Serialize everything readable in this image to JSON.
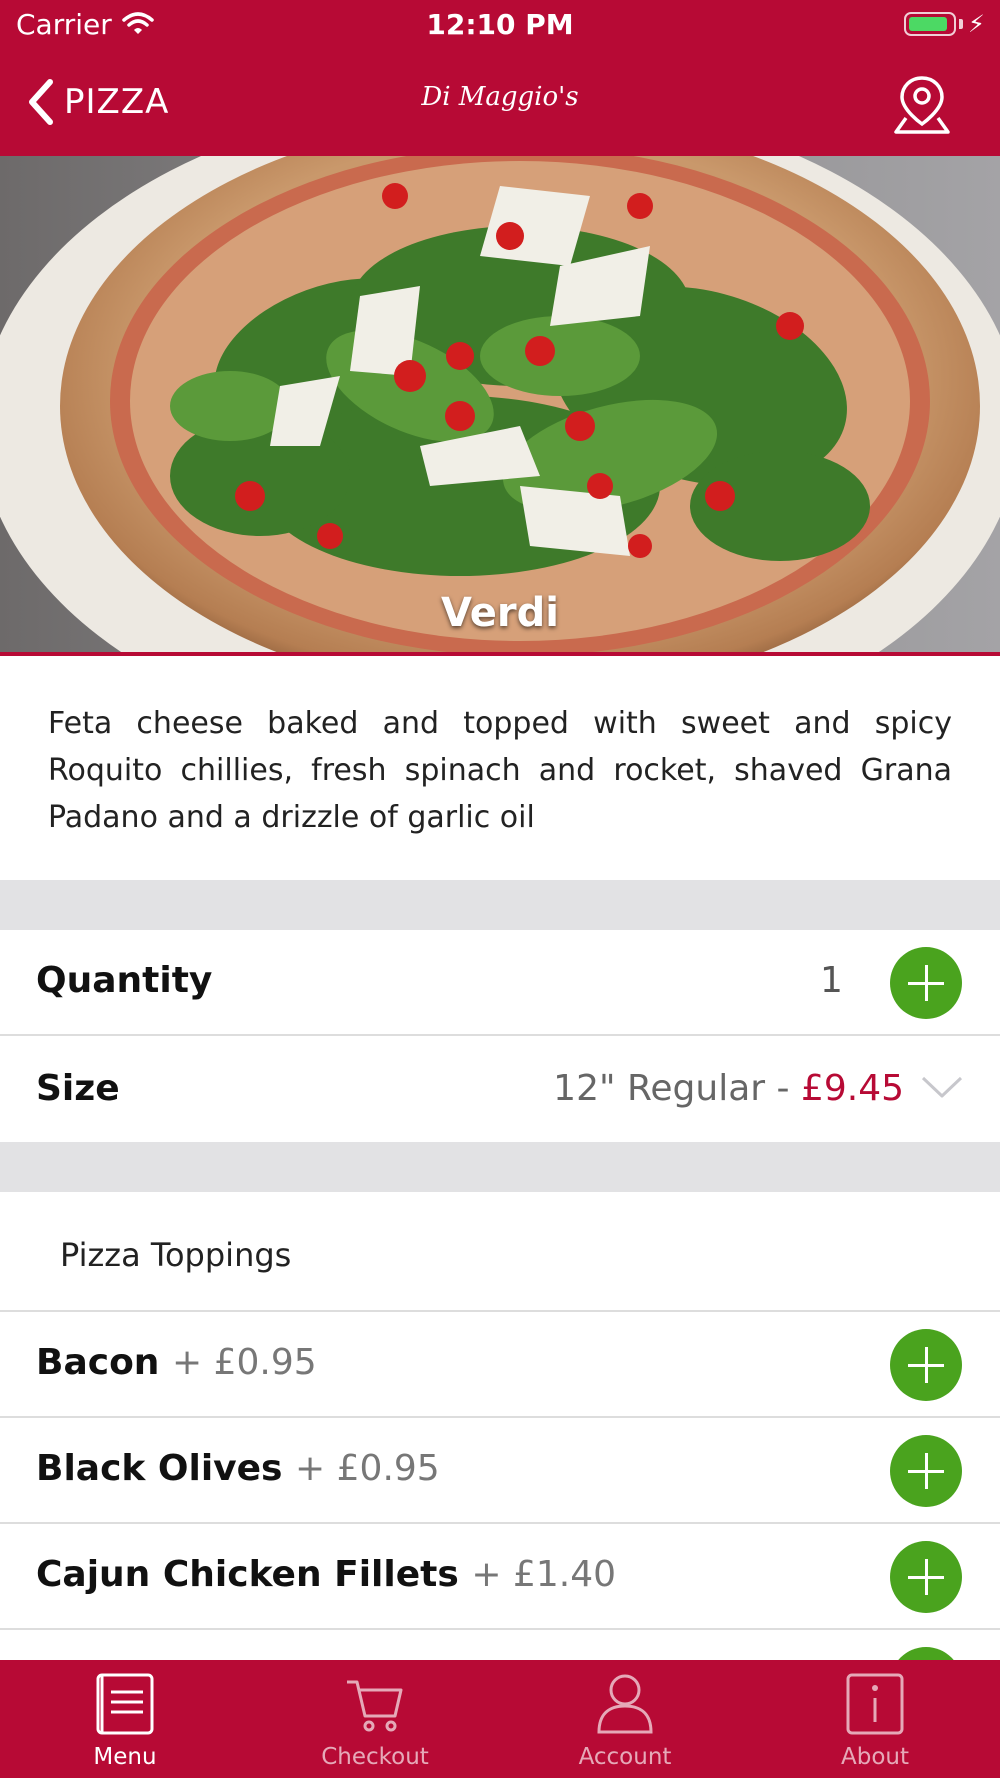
{
  "status_bar": {
    "carrier": "Carrier",
    "time": "12:10 PM",
    "battery_level": 0.9
  },
  "nav": {
    "back_label": "PIZZA",
    "logo_text": "Di Maggio's"
  },
  "product": {
    "name": "Verdi",
    "description": "Feta cheese baked and topped with sweet and spicy Roquito chillies, fresh spinach and rocket, shaved Grana Padano and a drizzle of garlic oil"
  },
  "quantity": {
    "label": "Quantity",
    "value": "1"
  },
  "size": {
    "label": "Size",
    "value": "12\" Regular - ",
    "price": "£9.45"
  },
  "toppings": {
    "section_title": "Pizza Toppings",
    "items": [
      {
        "name": "Bacon",
        "price": "+ £0.95"
      },
      {
        "name": "Black Olives",
        "price": "+ £0.95"
      },
      {
        "name": "Cajun Chicken Fillets",
        "price": "+ £1.40"
      }
    ]
  },
  "tabs": [
    {
      "label": "Menu",
      "icon": "menu-book-icon",
      "active": true
    },
    {
      "label": "Checkout",
      "icon": "cart-icon",
      "active": false
    },
    {
      "label": "Account",
      "icon": "person-icon",
      "active": false
    },
    {
      "label": "About",
      "icon": "info-icon",
      "active": false
    }
  ],
  "colors": {
    "brand": "#b70a35",
    "add_button": "#4aa31e",
    "price_accent": "#b70a35"
  }
}
